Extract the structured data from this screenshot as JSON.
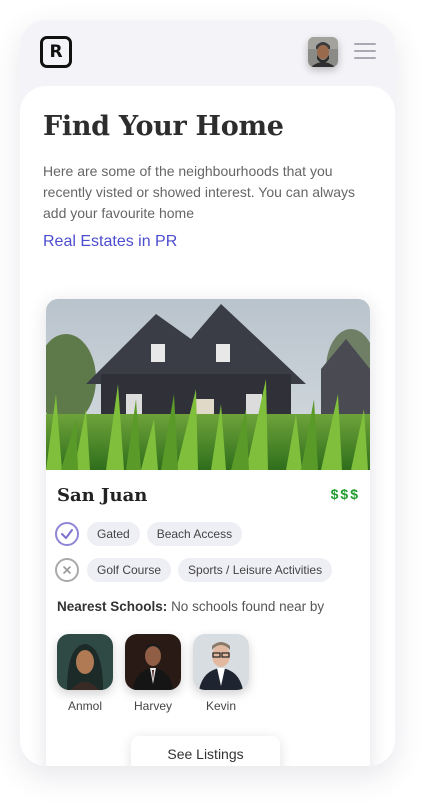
{
  "header": {
    "logo_letter": "R",
    "avatar": "user-avatar",
    "menu_icon": "hamburger-menu-icon"
  },
  "main": {
    "title": "Find Your Home",
    "description": "Here are some of the neighbourhoods that you recently visted or showed interest. You can always add your favourite home",
    "link_label": "Real Estates in PR"
  },
  "card": {
    "image": "house-photo",
    "city": "San Juan",
    "price": "$$$",
    "available_amenities": [
      "Gated",
      "Beach Access"
    ],
    "unavailable_amenities": [
      "Golf Course",
      "Sports / Leisure Activities"
    ],
    "schools_label": "Nearest Schools:",
    "schools_value": "No schools found near by",
    "people": [
      {
        "name": "Anmol"
      },
      {
        "name": "Harvey"
      },
      {
        "name": "Kevin"
      }
    ],
    "button_label": "See Listings"
  },
  "colors": {
    "accent": "#4d4dcf",
    "price": "#1f9d2d",
    "check": "#8e85d6"
  }
}
